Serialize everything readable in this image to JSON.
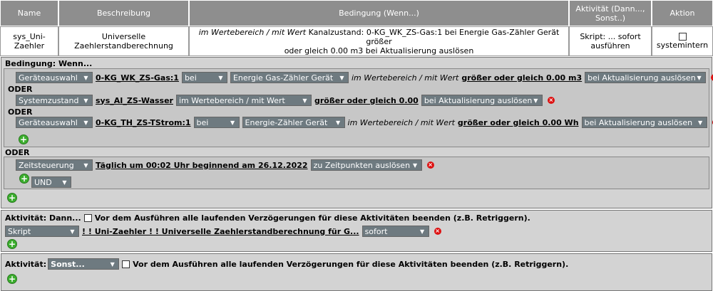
{
  "header": {
    "col_name": "Name",
    "col_desc": "Beschreibung",
    "col_cond": "Bedingung (Wenn...)",
    "col_activity_1": "Aktivität (Dann...,",
    "col_activity_2": "Sonst..)",
    "col_action": "Aktion"
  },
  "row": {
    "name_1": "sys_Uni-",
    "name_2": "Zaehler",
    "desc_1": "Universelle",
    "desc_2": "Zaehlerstandberechnung",
    "cond_prefix": "im Wertebereich / mit Wert",
    "cond_text_1": "Kanalzustand: 0-KG_WK_ZS-Gas:1 bei Energie Gas-Zähler Gerät größer",
    "cond_text_2": "oder gleich 0.00 m3 bei Aktualisierung auslösen",
    "activity_1": "Skript: ... sofort",
    "activity_2": "ausführen",
    "action_label": "systemintern"
  },
  "condition": {
    "title": "Bedingung: Wenn...",
    "or_label": "ODER",
    "c1": {
      "type": "Geräteauswahl",
      "channel": "0-KG_WK_ZS-Gas:1",
      "at": "bei",
      "device": "Energie Gas-Zähler Gerät",
      "range": "im Wertebereich / mit Wert",
      "value": "größer oder gleich 0.00 m3",
      "trigger": "bei Aktualisierung auslösen"
    },
    "c2": {
      "type": "Systemzustand",
      "channel": "sys_AI_ZS-Wasser",
      "range": "im Wertebereich / mit Wert",
      "value": "größer oder gleich 0.00",
      "trigger": "bei Aktualisierung auslösen"
    },
    "c3": {
      "type": "Geräteauswahl",
      "channel": "0-KG_TH_ZS-TStrom:1",
      "at": "bei",
      "device": "Energie-Zähler Gerät",
      "range": "im Wertebereich / mit Wert",
      "value": "größer oder gleich 0.00 Wh",
      "trigger": "bei Aktualisierung auslösen"
    },
    "time": {
      "type": "Zeitsteuerung",
      "schedule": "Täglich um 00:02 Uhr beginnend am 26.12.2022",
      "trigger": "zu Zeitpunkten auslösen",
      "and": "UND"
    }
  },
  "activity_then": {
    "label": "Aktivität: Dann...",
    "checkbox_text": "Vor dem Ausführen alle laufenden Verzögerungen für diese Aktivitäten beenden (z.B. Retriggern).",
    "type": "Skript",
    "script": "! ! Uni-Zaehler ! ! Universelle Zaehlerstandberechnung für G...",
    "timing": "sofort"
  },
  "activity_else": {
    "label": "Aktivität:",
    "select": "Sonst...",
    "checkbox_text": "Vor dem Ausführen alle laufenden Verzögerungen für diese Aktivitäten beenden (z.B. Retriggern)."
  },
  "icons": {
    "dropdown": "chevron-down-icon",
    "delete": "delete-icon",
    "add": "add-icon"
  }
}
